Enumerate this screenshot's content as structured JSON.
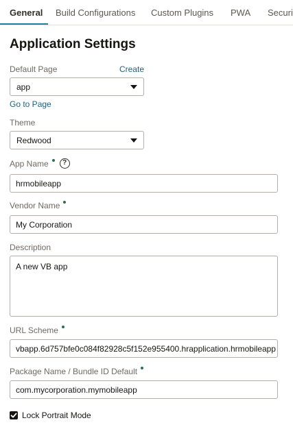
{
  "tabs": [
    {
      "label": "General",
      "active": true
    },
    {
      "label": "Build Configurations",
      "active": false
    },
    {
      "label": "Custom Plugins",
      "active": false
    },
    {
      "label": "PWA",
      "active": false
    },
    {
      "label": "Security",
      "active": false
    }
  ],
  "page_title": "Application Settings",
  "default_page": {
    "label": "Default Page",
    "create_link": "Create",
    "value": "app",
    "go_to_page": "Go to Page"
  },
  "theme": {
    "label": "Theme",
    "value": "Redwood"
  },
  "app_name": {
    "label": "App Name",
    "value": "hrmobileapp",
    "help_icon": "?"
  },
  "vendor_name": {
    "label": "Vendor Name",
    "value": "My Corporation"
  },
  "description": {
    "label": "Description",
    "value": "A new VB app"
  },
  "url_scheme": {
    "label": "URL Scheme",
    "value": "vbapp.6d757bfe0c084f82928c5f152e955400.hrapplication.hrmobileapp"
  },
  "package_name": {
    "label": "Package Name / Bundle ID Default",
    "value": "com.mycorporation.mymobileapp"
  },
  "lock_portrait": {
    "label": "Lock Portrait Mode",
    "checked": true
  },
  "colors": {
    "accent": "#227e9e",
    "link": "#1b6381",
    "required_dot": "#2f6e4a"
  }
}
